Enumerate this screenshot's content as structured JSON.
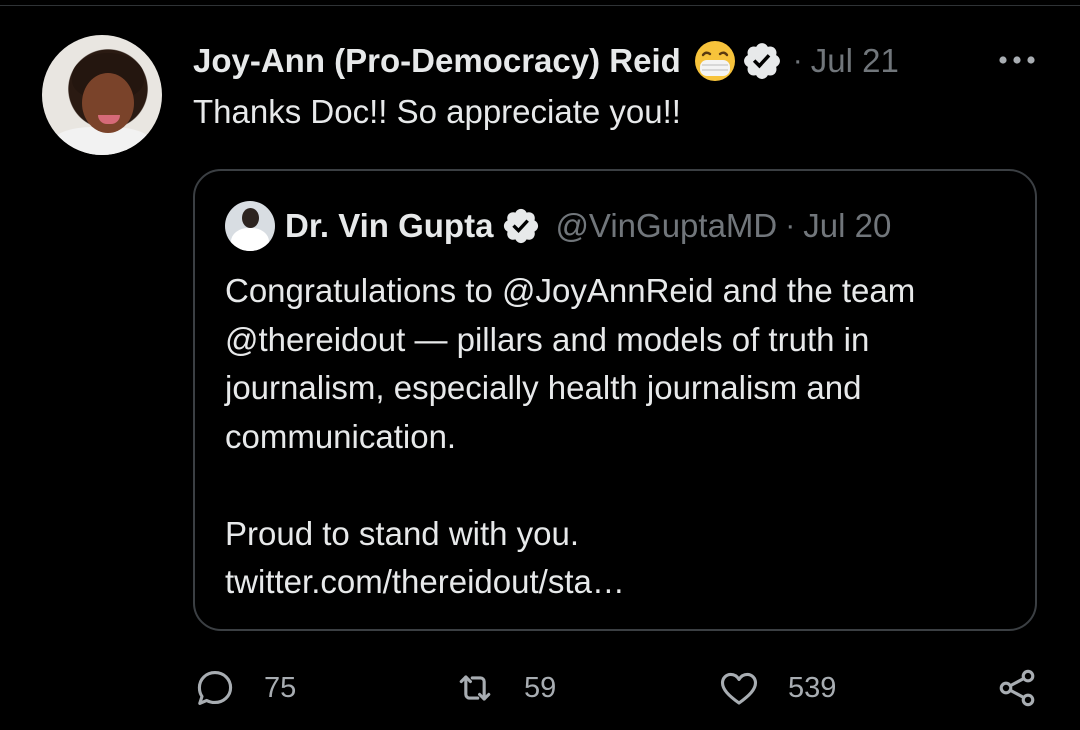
{
  "tweet": {
    "author_name": "Joy-Ann (Pro-Democracy) Reid",
    "separator": "·",
    "date": "Jul 21",
    "text": "Thanks Doc!! So appreciate you!!"
  },
  "quoted_tweet": {
    "author_name": "Dr. Vin Gupta",
    "handle": "@VinGuptaMD",
    "separator": "·",
    "date": "Jul 20",
    "lines": [
      "Congratulations to @JoyAnnReid and the team",
      "@thereidout — pillars and models of truth in",
      "journalism, especially health journalism and",
      "communication."
    ],
    "lines2": [
      "Proud to stand with you.",
      "twitter.com/thereidout/sta…"
    ]
  },
  "actions": {
    "reply_count": "75",
    "retweet_count": "59",
    "like_count": "539"
  },
  "icons": {
    "more": "more-dots-icon",
    "emoji": "face-with-medical-mask-icon",
    "verified": "verified-badge-icon",
    "reply": "reply-icon",
    "retweet": "retweet-icon",
    "like": "heart-icon",
    "share": "share-icon"
  },
  "colors": {
    "background": "#000000",
    "text": "#e7e9ea",
    "secondary": "#71767b",
    "border": "#3b3f43"
  }
}
